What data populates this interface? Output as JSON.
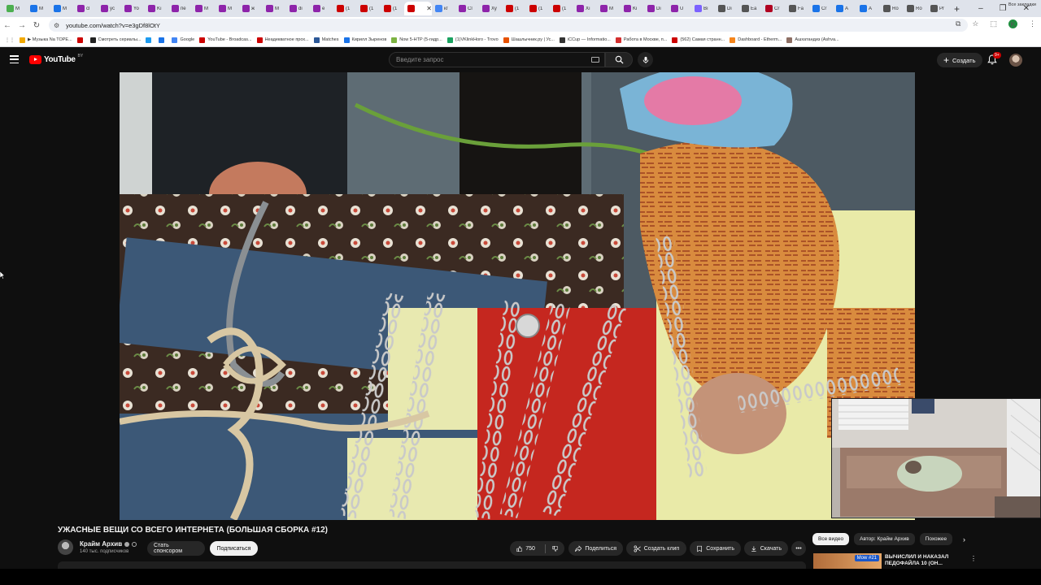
{
  "browser": {
    "tabs": [
      {
        "label": "M",
        "color": "#4caf50"
      },
      {
        "label": "M",
        "color": "#1a73e8"
      },
      {
        "label": "M",
        "color": "#1a73e8"
      },
      {
        "label": "cl",
        "color": "#8e24aa"
      },
      {
        "label": "yc",
        "color": "#8e24aa"
      },
      {
        "label": "Yo",
        "color": "#8e24aa"
      },
      {
        "label": "Kı",
        "color": "#8e24aa"
      },
      {
        "label": "пе",
        "color": "#8e24aa"
      },
      {
        "label": "M",
        "color": "#8e24aa"
      },
      {
        "label": "M",
        "color": "#8e24aa"
      },
      {
        "label": "ж",
        "color": "#8e24aa"
      },
      {
        "label": "M",
        "color": "#8e24aa"
      },
      {
        "label": "di",
        "color": "#8e24aa"
      },
      {
        "label": "e",
        "color": "#8e24aa"
      },
      {
        "label": "(1",
        "color": "#cc0000"
      },
      {
        "label": "(1",
        "color": "#cc0000"
      },
      {
        "label": "(1",
        "color": "#cc0000"
      },
      {
        "label": "",
        "color": "#cc0000",
        "active": true
      },
      {
        "label": "кг",
        "color": "#4285f4"
      },
      {
        "label": "Cl",
        "color": "#8e24aa"
      },
      {
        "label": "Ху",
        "color": "#8e24aa"
      },
      {
        "label": "(1",
        "color": "#cc0000"
      },
      {
        "label": "(1",
        "color": "#cc0000"
      },
      {
        "label": "(1",
        "color": "#cc0000"
      },
      {
        "label": "Xı",
        "color": "#8e24aa"
      },
      {
        "label": "M",
        "color": "#8e24aa"
      },
      {
        "label": "Ki",
        "color": "#8e24aa"
      },
      {
        "label": "Di",
        "color": "#8e24aa"
      },
      {
        "label": "U",
        "color": "#8e24aa"
      },
      {
        "label": "Вı",
        "color": "#7b61ff"
      },
      {
        "label": "Di",
        "color": "#555555"
      },
      {
        "label": "Ea",
        "color": "#555555"
      },
      {
        "label": "Cr",
        "color": "#b00020"
      },
      {
        "label": "Fa",
        "color": "#555555"
      },
      {
        "label": "Cr",
        "color": "#1a73e8"
      },
      {
        "label": "A",
        "color": "#1a73e8"
      },
      {
        "label": "A",
        "color": "#1a73e8"
      },
      {
        "label": "Ro",
        "color": "#555555"
      },
      {
        "label": "Ro",
        "color": "#555555"
      },
      {
        "label": "Pr",
        "color": "#555555"
      }
    ],
    "window_controls": [
      "–",
      "❐",
      "✕"
    ],
    "url": "youtube.com/watch?v=e3gDf8lOtY",
    "profile_letter": "K",
    "bookmarks": [
      {
        "label": "▶ Музыка Na TOPE...",
        "color": "#f2a900"
      },
      {
        "label": "",
        "color": "#cc0000"
      },
      {
        "label": "Смотреть сериалы...",
        "color": "#222222"
      },
      {
        "label": "",
        "color": "#1d9bf0"
      },
      {
        "label": "",
        "color": "#1a73e8"
      },
      {
        "label": "Google",
        "color": "#4285f4"
      },
      {
        "label": "YouTube - Broadcas...",
        "color": "#cc0000"
      },
      {
        "label": "Неадекватное прох...",
        "color": "#cc0000"
      },
      {
        "label": "Matches",
        "color": "#2b5797"
      },
      {
        "label": "Кирилл Зыренов",
        "color": "#1a73e8"
      },
      {
        "label": "Now 5-HTP (5-гидр...",
        "color": "#7cb342"
      },
      {
        "label": "(1)VKlinkHoro - Trovo",
        "color": "#1aa260"
      },
      {
        "label": "Шашлычник.ру | Ус...",
        "color": "#e65100"
      },
      {
        "label": "iCCup — Informatio...",
        "color": "#333333"
      },
      {
        "label": "Работа в Москве, п...",
        "color": "#d32f2f"
      },
      {
        "label": "(562) Самая странн...",
        "color": "#cc0000"
      },
      {
        "label": "Dashboard - Etherm...",
        "color": "#f6851b"
      },
      {
        "label": "Ашхатандиз (Ashva...",
        "color": "#8d6e63"
      }
    ],
    "all_bookmarks": "Все закладки"
  },
  "youtube": {
    "logo": "YouTube",
    "region": "BY",
    "search_placeholder": "Введите запрос",
    "create_label": "Создать",
    "notif_count": "9+"
  },
  "video": {
    "title": "УЖАСНЫЕ ВЕЩИ СО ВСЕГО ИНТЕРНЕТА (БОЛЬШАЯ СБОРКА #12)",
    "channel": "Крайм Архив",
    "subscribers": "140 тыс. подписчиков",
    "sponsor_label": "Стать спонсором",
    "subscribe_label": "Подписаться",
    "likes": "750",
    "share_label": "Поделиться",
    "clip_label": "Создать клип",
    "save_label": "Сохранить",
    "download_label": "Скачать",
    "more_label": "•••"
  },
  "sidebar": {
    "chips": [
      "Все видео",
      "Автор: Крайм Архив",
      "Похожее"
    ],
    "rec_title": "ВЫЧИСЛИЛ И НАКАЗАЛ ПЕДОФАЙЛА 10 (ОН...",
    "rec_tag": "Mow #21"
  },
  "colors": {
    "accent": "#ff0000",
    "bg": "#0f0f0f",
    "chip_bg": "#272727"
  }
}
